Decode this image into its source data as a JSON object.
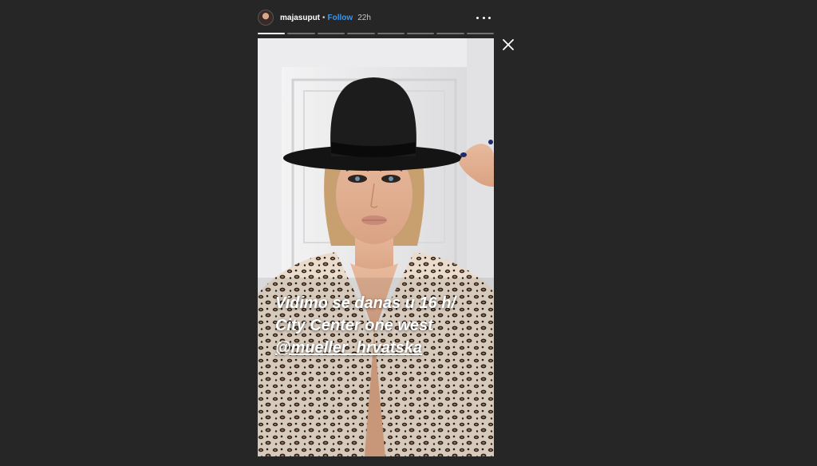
{
  "story": {
    "username": "majasuput",
    "separator": "•",
    "follow_label": "Follow",
    "time_ago": "22h",
    "segments": [
      1,
      0,
      0,
      0,
      0,
      0,
      0,
      0
    ],
    "caption": {
      "line1": "Vidimo se danas u 16 h/",
      "line2": "City Center one west",
      "line3": "@mueller_hrvatska"
    }
  },
  "icons": {
    "avatar": "profile-avatar",
    "more": "more-options-icon",
    "close": "close-icon"
  },
  "colors": {
    "background": "#262626",
    "follow": "#3897f0",
    "text": "#ffffff"
  }
}
